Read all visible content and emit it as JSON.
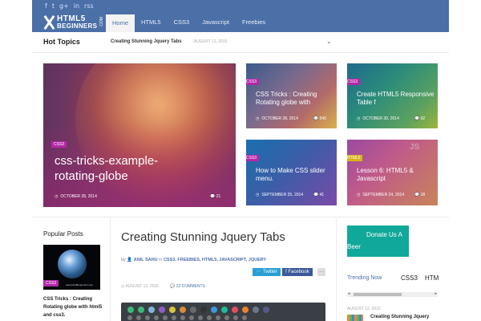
{
  "social": [
    "f",
    "t",
    "g+",
    "in",
    "rss"
  ],
  "logo": {
    "line1": "HTML5",
    "line2": "BEGINNERS",
    "suffix": ".COM"
  },
  "nav": [
    "Home",
    "HTML5",
    "CSS3",
    "Javascript",
    "Freebies"
  ],
  "hot": {
    "title": "Hot Topics",
    "link": "Creating Stunning Jquery Tabs",
    "date": "- AUGUST 12, 2015",
    "chevron": "⌄"
  },
  "featured": {
    "big": {
      "tag": "CSS3",
      "title": "css-tricks-example-rotating-globe",
      "date": "OCTOBER 28, 2014",
      "comments": "21"
    },
    "t1": {
      "tag": "CSS3",
      "title": "CSS Tricks : Creating Rotating globe with",
      "date": "OCTOBER 28, 2014",
      "comments": "540"
    },
    "t2": {
      "tag": "CSS3",
      "title": "Create HTML5 Responsive Table f",
      "date": "OCTOBER 30, 2014",
      "comments": "92"
    },
    "t3": {
      "tag": "CSS3",
      "title": "How to Make CSS slider menu.",
      "date": "SEPTEMBER 25, 2014",
      "comments": "41"
    },
    "t4": {
      "tag": "HTML5",
      "title": "Lesson 6: HTML5 & Javascript",
      "date": "SEPTEMBER 24, 2014",
      "comments": "18"
    }
  },
  "popular": {
    "title": "Popular Posts",
    "caption": "www.html5beginners.com",
    "tag": "CSS3",
    "text": "CSS Tricks : Creating Rotating globe with html5 and css3."
  },
  "article": {
    "title": "Creating Stunning Jquery Tabs",
    "by": "by",
    "author": "ANIL SAHU",
    "in": "in",
    "categories": "CSS3, FREEBIES, HTML5, JAVASCRIPT, JQUERY",
    "twitter": "Twitter",
    "facebook": "Facebook",
    "more": "···",
    "date": "AUGUST 12, 2015",
    "comments": "22 COMMENTS"
  },
  "sidebar": {
    "donate_line1": "Donate Us A",
    "donate_line2": "Beer",
    "trending": "Trending Now",
    "tab1": "CSS3",
    "tab2": "HTM",
    "left_arrow": "◂",
    "right_arrow": "▸",
    "trend_date": "AUGUST 12, 2015",
    "trend_title": "Creating Stunning Jquery"
  },
  "colors": {
    "brand": "#4b6fa7",
    "tag": "#b428a8",
    "donate": "#10a89a",
    "demo_dots": [
      "#3cb878",
      "#3cb878",
      "#7fb7d9",
      "#8e5fc2",
      "#d9c43a",
      "#d98a3a",
      "#6a6a6a",
      "#333333",
      "#3a9ad9",
      "#1abc9c",
      "#e84c5c",
      "#e8842c",
      "#6a7a8a",
      "#5a5a8a"
    ]
  }
}
